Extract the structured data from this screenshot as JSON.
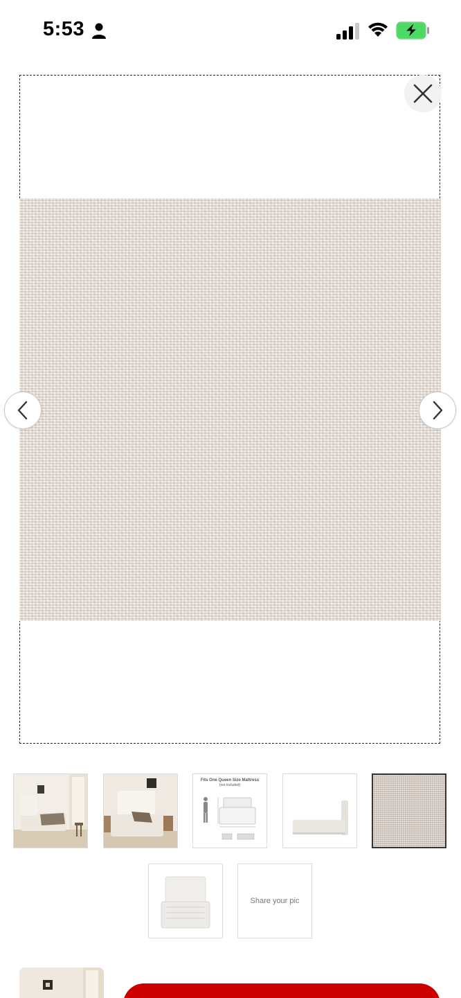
{
  "status_bar": {
    "time": "5:53",
    "icons": [
      "person-icon",
      "cellular-signal-icon",
      "wifi-icon",
      "battery-charging-icon"
    ],
    "battery_color": "#4cd964"
  },
  "viewer": {
    "current_image": "fabric texture swatch",
    "close_icon": "close-icon",
    "prev_icon": "chevron-left-icon",
    "next_icon": "chevron-right-icon"
  },
  "thumbnails": [
    {
      "type": "photo",
      "subject": "bedroom with bed"
    },
    {
      "type": "photo",
      "subject": "bed with throw blanket"
    },
    {
      "type": "diagram",
      "title": "Fits One Queen Size Mattress",
      "subtitle": "(not included)"
    },
    {
      "type": "photo",
      "subject": "bed side view"
    },
    {
      "type": "photo",
      "subject": "fabric swatch",
      "selected": true
    },
    {
      "type": "photo",
      "subject": "bed top view"
    },
    {
      "type": "action",
      "label": "Share your pic"
    }
  ],
  "colors": {
    "accent": "#cc0000",
    "selected_border": "#333333"
  }
}
